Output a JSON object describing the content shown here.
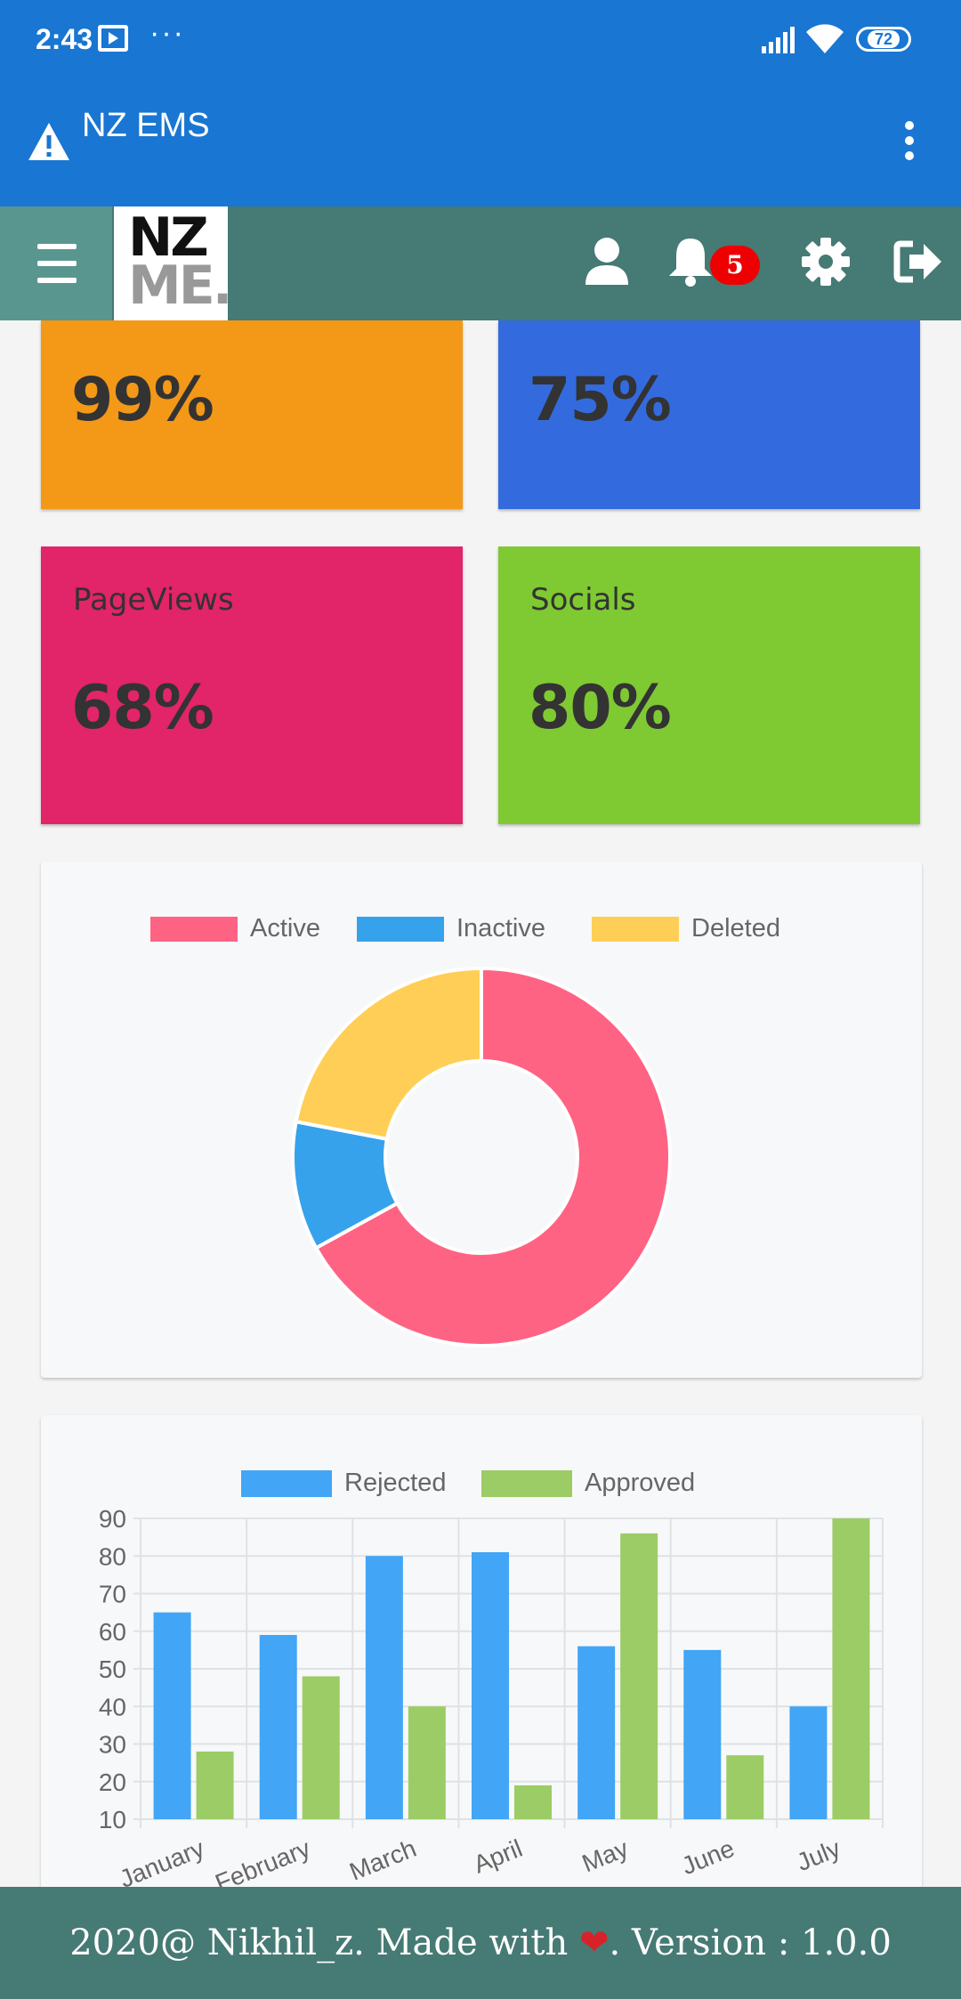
{
  "status_bar": {
    "time": "2:43",
    "dots": "···",
    "battery": "72"
  },
  "app_bar": {
    "title": "NZ EMS"
  },
  "nav": {
    "logo_line1": "NZ",
    "logo_line2": "ME.",
    "notification_count": "5"
  },
  "cards": [
    {
      "label": "",
      "value": "99%",
      "color": "#f39817"
    },
    {
      "label": "",
      "value": "75%",
      "color": "#336bdf"
    },
    {
      "label": "PageViews",
      "value": "68%",
      "color": "#e22468"
    },
    {
      "label": "Socials",
      "value": "80%",
      "color": "#7fc932"
    }
  ],
  "chart_data": [
    {
      "type": "doughnut",
      "legend_position": "top",
      "series": [
        {
          "name": "Active",
          "value": 67,
          "color": "#ff6384"
        },
        {
          "name": "Inactive",
          "value": 11,
          "color": "#36a2eb"
        },
        {
          "name": "Deleted",
          "value": 22,
          "color": "#ffce56"
        }
      ]
    },
    {
      "type": "bar",
      "legend_position": "top",
      "grid": true,
      "categories": [
        "January",
        "February",
        "March",
        "April",
        "May",
        "June",
        "July"
      ],
      "ylim": [
        10,
        90
      ],
      "yticks": [
        "90",
        "80",
        "70",
        "60",
        "50",
        "40",
        "30",
        "20",
        "10"
      ],
      "series": [
        {
          "name": "Rejected",
          "color": "#42a5f5",
          "values": [
            65,
            59,
            80,
            81,
            56,
            55,
            40
          ]
        },
        {
          "name": "Approved",
          "color": "#9ccc65",
          "values": [
            28,
            48,
            40,
            19,
            86,
            27,
            90
          ]
        }
      ]
    }
  ],
  "footer": {
    "text_before": "2020@ Nikhil_z. Made with ",
    "heart": "❤",
    "text_after": ". Version : 1.0.0"
  }
}
